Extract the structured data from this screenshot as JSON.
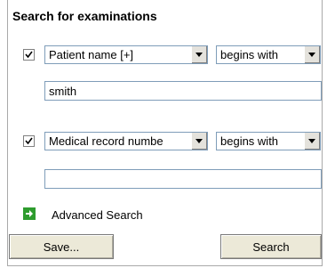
{
  "panel": {
    "title": "Search for examinations"
  },
  "criteria": [
    {
      "checked": true,
      "field": "Patient name [+]",
      "operator": "begins with",
      "value": "smith"
    },
    {
      "checked": true,
      "field": "Medical record numbe",
      "operator": "begins with",
      "value": ""
    }
  ],
  "advanced": {
    "label": "Advanced Search",
    "icon": "green-arrow-right-icon"
  },
  "buttons": {
    "save": "Save...",
    "search": "Search"
  },
  "colors": {
    "accent_green": "#2e9c2e",
    "border": "#7f9db9"
  }
}
